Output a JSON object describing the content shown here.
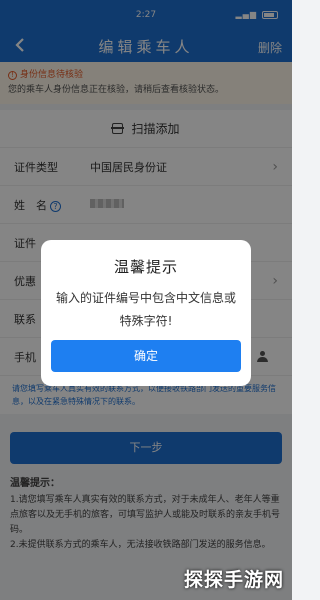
{
  "status_bar": {
    "time": "2:27",
    "signal": "▂▄▆"
  },
  "nav": {
    "back_icon": "chevron-left-icon",
    "title": "编辑乘车人",
    "right_label": "删除"
  },
  "warning": {
    "title": "身份信息待核验",
    "text": "您的乘车人身份信息正在核验，请稍后查看核验状态。"
  },
  "form": {
    "scan_label": "扫描添加",
    "id_type_label": "证件类型",
    "id_type_value": "中国居民身份证",
    "name_label": "姓　名",
    "id_number_label": "证件",
    "country_label": "优惠",
    "contact_label": "联系",
    "phone_label": "手机"
  },
  "notice_text": "请您填写乘车人真实有效的联系方式，以便接收铁路部门发送的重要服务信息，以及在紧急特殊情况下的联系。",
  "next_button": "下一步",
  "tips": {
    "title": "温馨提示：",
    "lines": [
      "1.请您填写乘车人真实有效的联系方式，对于未成年人、老年人等重点旅客以及无手机的旅客，可填写监护人或能及时联系的亲友手机号码。",
      "2.未提供联系方式的乘车人，无法接收铁路部门发送的服务信息。"
    ]
  },
  "dialog": {
    "title": "温馨提示",
    "message": "输入的证件编号中包含中文信息或特殊字符!",
    "confirm": "确定"
  },
  "watermark": "探探手游网",
  "colors": {
    "primary": "#1e6fd1",
    "error": "#e43b3b",
    "warning": "#e45b2a"
  }
}
